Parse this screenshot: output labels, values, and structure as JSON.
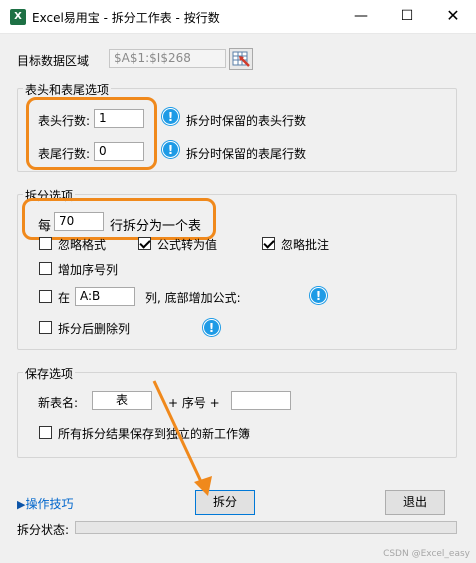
{
  "window": {
    "title": "Excel易用宝 - 拆分工作表 - 按行数",
    "app_icon_letter": "X",
    "minimize": "—",
    "maximize": "☐",
    "close": "✕"
  },
  "target": {
    "label": "目标数据区域",
    "value": "$A$1:$I$268"
  },
  "header_footer": {
    "title": "表头和表尾选项",
    "header_rows_label": "表头行数:",
    "header_rows_value": "1",
    "header_rows_hint": "拆分时保留的表头行数",
    "footer_rows_label": "表尾行数:",
    "footer_rows_value": "0",
    "footer_rows_hint": "拆分时保留的表尾行数"
  },
  "split_options": {
    "title": "拆分选项",
    "per_prefix": "每",
    "rows_value": "70",
    "per_suffix": "行拆分为一个表",
    "ignore_format": {
      "label": "忽略格式",
      "checked": false
    },
    "formula_to_value": {
      "label": "公式转为值",
      "checked": true
    },
    "ignore_comments": {
      "label": "忽略批注",
      "checked": true
    },
    "add_serial": {
      "label": "增加序号列",
      "checked": false
    },
    "add_formula": {
      "prefix": "在",
      "column_value": "A:B",
      "suffix": "列, 底部增加公式:",
      "checked": false
    },
    "delete_after": {
      "label": "拆分后删除列",
      "checked": false
    }
  },
  "save_options": {
    "title": "保存选项",
    "new_name_label": "新表名:",
    "new_name_value": "表",
    "plus_serial": "+ 序号 +",
    "suffix_value": "",
    "save_separate": {
      "label": "所有拆分结果保存到独立的新工作簿",
      "checked": false
    }
  },
  "footer": {
    "tips_label": "操作技巧",
    "split_button": "拆分",
    "exit_button": "退出",
    "status_label": "拆分状态:",
    "progress": 0
  },
  "icons": {
    "info": "!"
  },
  "watermark": "CSDN @Excel_easy",
  "colors": {
    "highlight": "#f0891c",
    "info": "#1e9be6",
    "link": "#0066cc"
  }
}
